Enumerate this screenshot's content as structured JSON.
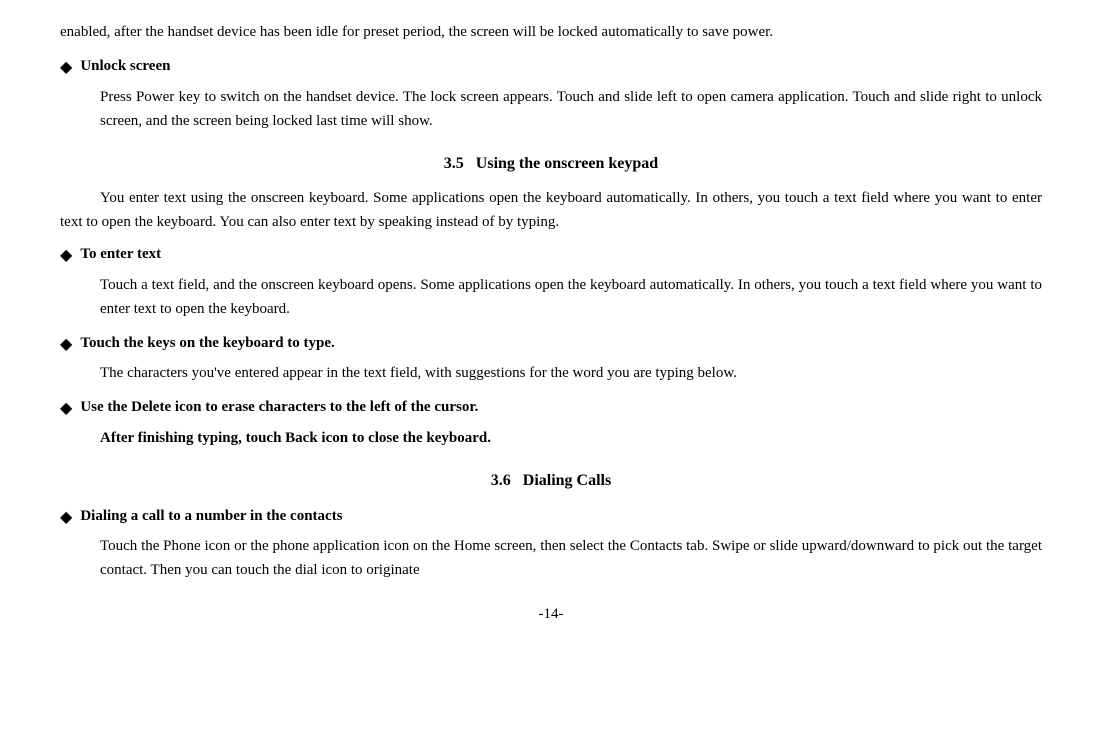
{
  "intro": {
    "text": "enabled, after the handset device has been idle for preset period, the screen will be locked automatically to save power."
  },
  "unlock_screen": {
    "title": "Unlock screen",
    "body": "Press Power key to switch on the handset device. The lock screen appears. Touch and slide left to open camera application. Touch and slide right to unlock screen, and the screen being locked last time will show."
  },
  "section_35": {
    "number": "3.5",
    "title": "Using the onscreen keypad",
    "intro": "You enter text using the onscreen keyboard. Some applications open the keyboard automatically. In others, you touch a text field where you want to enter text to open the keyboard. You can also enter text by speaking instead of by typing."
  },
  "to_enter_text": {
    "title": "To enter text",
    "body": "Touch a text field, and the onscreen keyboard opens. Some applications open the keyboard automatically. In others, you touch a text field where you want to enter text to open the keyboard."
  },
  "touch_keys": {
    "title": "Touch the keys on the keyboard to type.",
    "body": "The characters you've entered appear in the text field, with suggestions for the word you are typing below."
  },
  "use_delete": {
    "title": "Use the Delete icon to erase characters to the left of the cursor.",
    "bold_line": "After finishing typing, touch Back icon to close the keyboard."
  },
  "section_36": {
    "number": "3.6",
    "title": "Dialing Calls"
  },
  "dialing_contacts": {
    "title": "Dialing a call to a number in the contacts",
    "body": "Touch the Phone icon or the phone application icon on the Home screen, then select the Contacts tab. Swipe or slide upward/downward to pick out the target contact. Then you can touch the dial icon to originate"
  },
  "page_number": "-14-"
}
